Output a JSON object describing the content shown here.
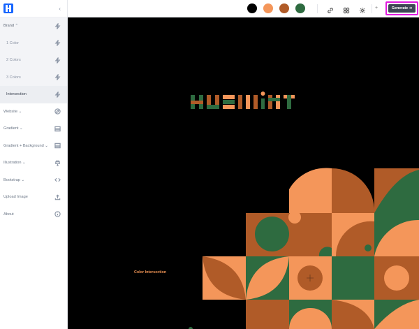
{
  "sidebar": {
    "collapse_icon": "chevron-left-icon",
    "items": [
      {
        "label": "Brand ⌃",
        "icon": "bolt-icon"
      },
      {
        "label": "1 Color",
        "icon": "bolt-icon"
      },
      {
        "label": "2 Colors",
        "icon": "bolt-icon"
      },
      {
        "label": "3 Colors",
        "icon": "bolt-icon"
      },
      {
        "label": "Intersection",
        "icon": "bolt-icon"
      },
      {
        "label": "Website ⌄",
        "icon": "compass-icon"
      },
      {
        "label": "Gradient ⌄",
        "icon": "gradient-icon"
      },
      {
        "label": "Gradient + Background ⌄",
        "icon": "gradient-icon"
      },
      {
        "label": "Illustration ⌄",
        "icon": "paint-bucket-icon"
      },
      {
        "label": "Bootstrap ⌄",
        "icon": "code-icon"
      },
      {
        "label": "Upload Image",
        "icon": "upload-icon"
      },
      {
        "label": "About",
        "icon": "info-icon"
      }
    ]
  },
  "topbar": {
    "colors": [
      "#000000",
      "#F4965A",
      "#B05B28",
      "#2E6B40"
    ],
    "generate_label": "Generate ➜",
    "plus_label": "+"
  },
  "canvas": {
    "logo_text": "HUEMINT",
    "caption": "Color Intersection",
    "palette": {
      "bg": "#000000",
      "light": "#F4965A",
      "mid": "#B05B28",
      "dark": "#2E6B40"
    }
  }
}
